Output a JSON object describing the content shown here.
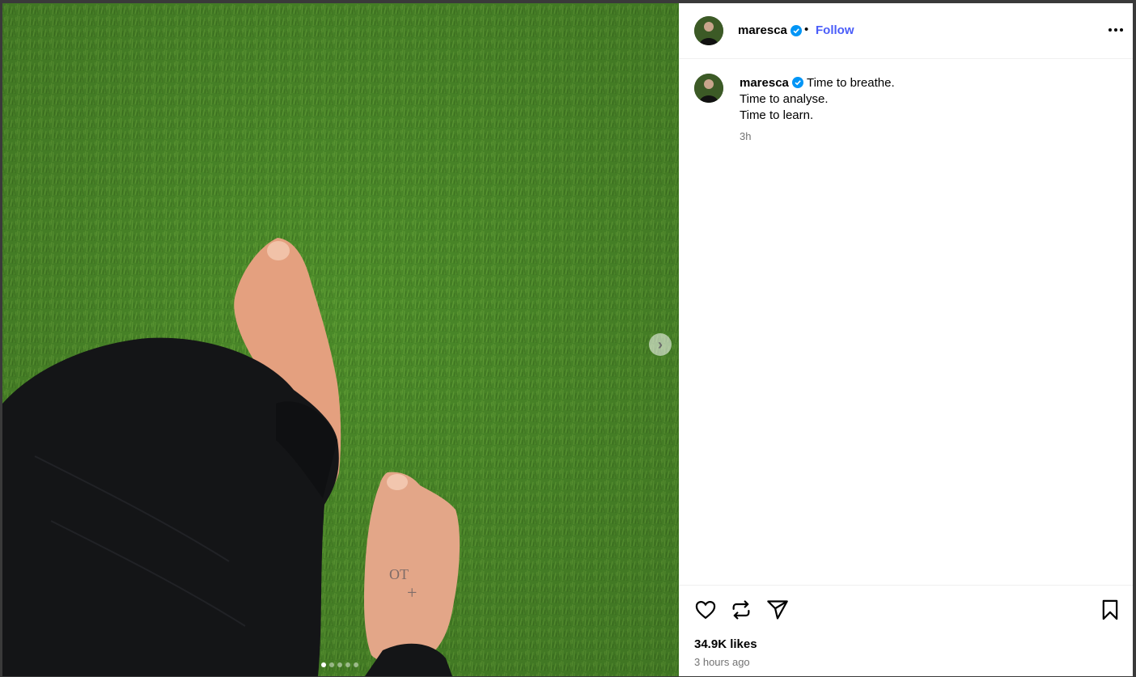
{
  "post": {
    "username": "maresca",
    "follow_label": "Follow",
    "separator": "•",
    "caption_lines": [
      "Time to breathe.",
      "Time to analyse.",
      "Time to learn."
    ],
    "relative_time": "3h",
    "likes": "34.9K likes",
    "posted_ago": "3 hours ago"
  },
  "carousel": {
    "slide_count": 5,
    "active_index": 0,
    "next_label": "›"
  },
  "icons": {
    "verified": "verified-badge-icon",
    "more": "more-options-icon",
    "like": "heart-icon",
    "repost": "repost-icon",
    "share": "send-icon",
    "save": "bookmark-icon",
    "next": "chevron-right-icon"
  },
  "colors": {
    "accent": "#4a5df9",
    "verified": "#0095f6",
    "muted": "#737373",
    "grass": "#4d8a2a"
  }
}
